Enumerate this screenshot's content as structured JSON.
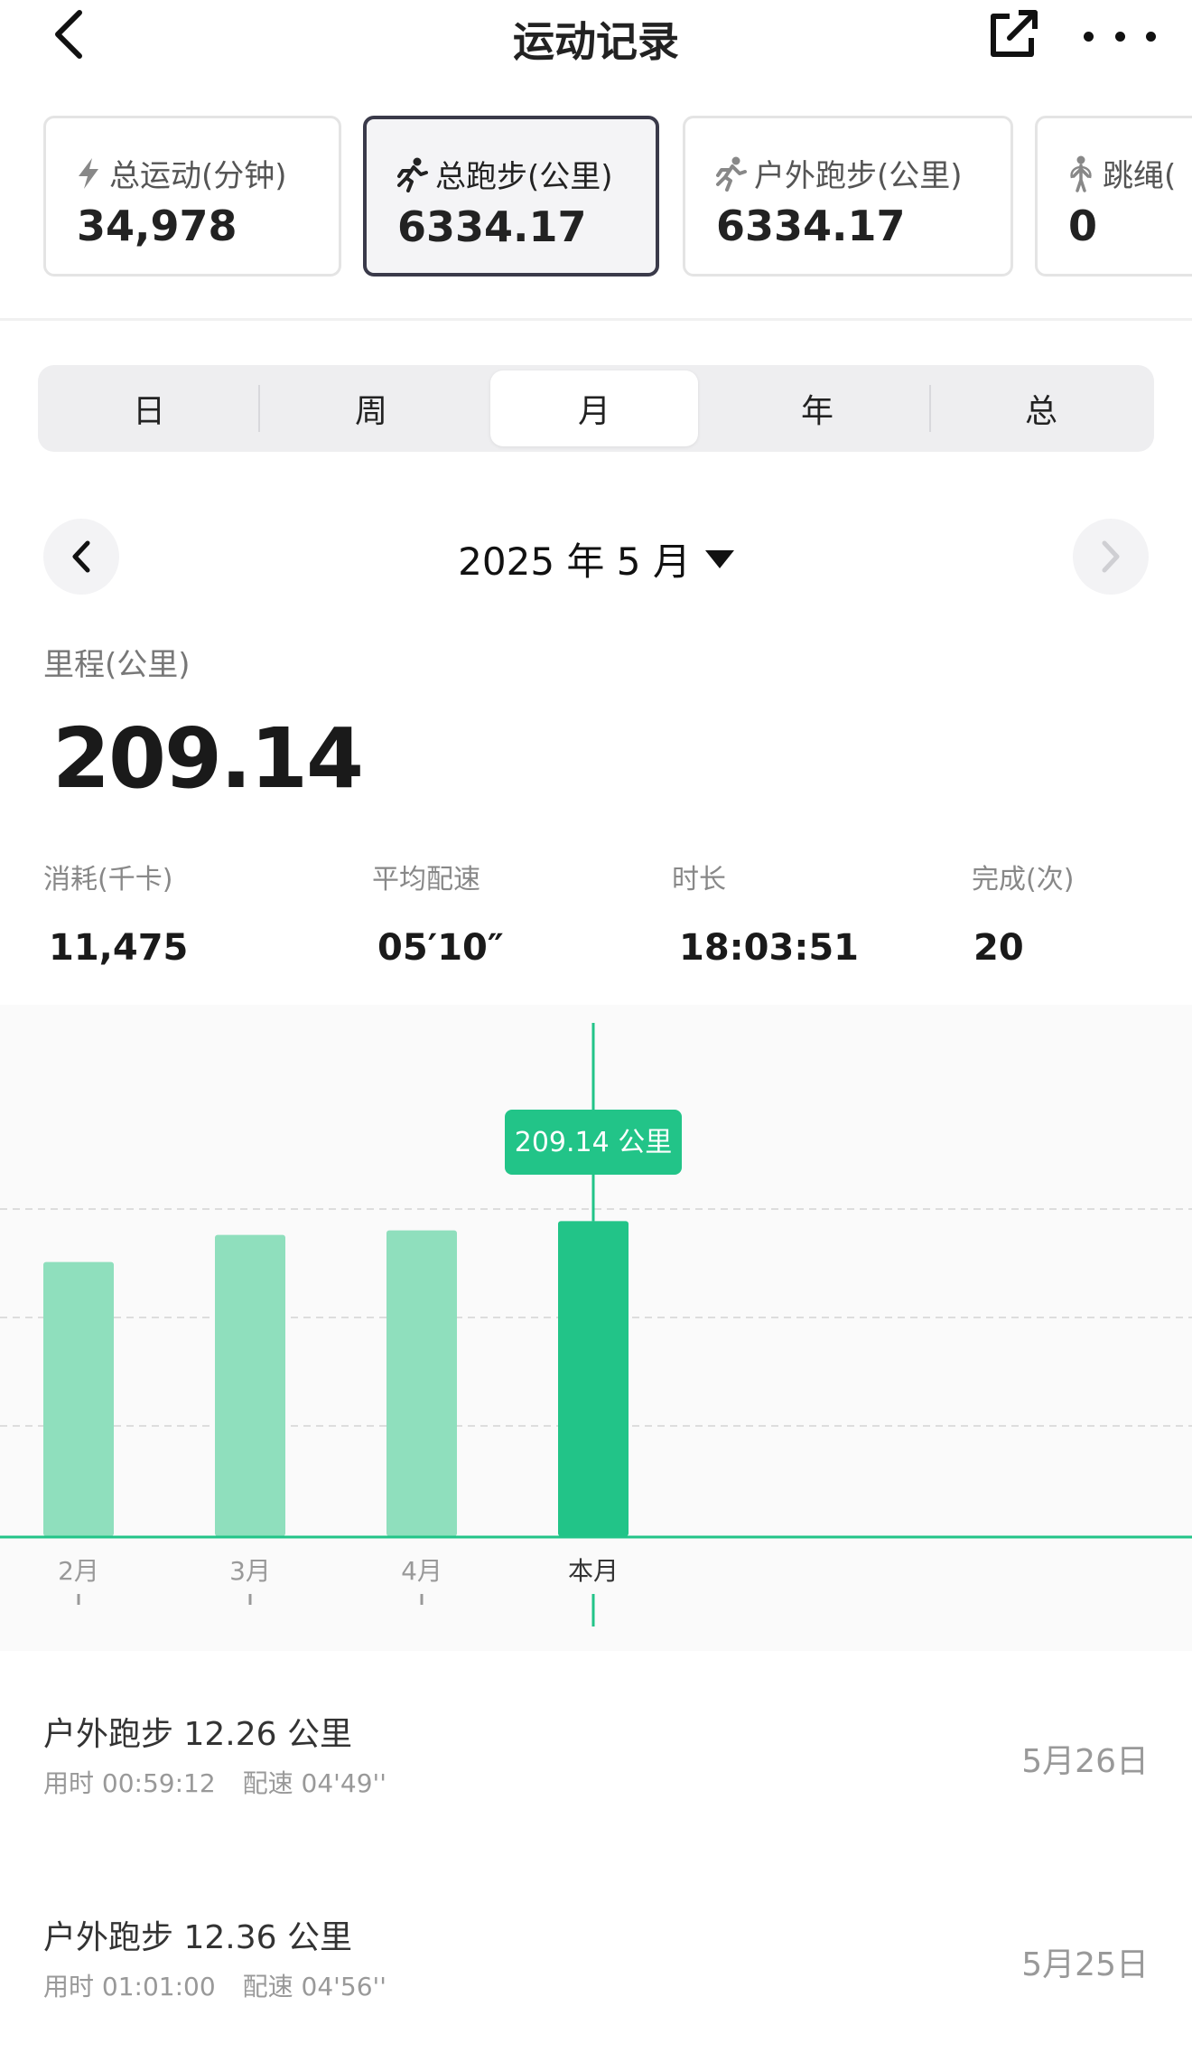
{
  "header": {
    "title": "运动记录"
  },
  "cards": [
    {
      "label": "总运动(分钟)",
      "value": "34,978",
      "icon": "lightning-icon"
    },
    {
      "label": "总跑步(公里)",
      "value": "6334.17",
      "icon": "runner-icon"
    },
    {
      "label": "户外跑步(公里)",
      "value": "6334.17",
      "icon": "outdoor-runner-icon"
    },
    {
      "label": "跳绳(",
      "value": "0",
      "icon": "jump-rope-icon"
    }
  ],
  "segments": [
    "日",
    "周",
    "月",
    "年",
    "总"
  ],
  "active_segment": "月",
  "month_picker": {
    "label": "2025 年 5 月"
  },
  "metric": {
    "label": "里程(公里)",
    "value": "209.14"
  },
  "stats": [
    {
      "label": "消耗(千卡)",
      "value": "11,475"
    },
    {
      "label": "平均配速",
      "value": "05′10″"
    },
    {
      "label": "时长",
      "value": "18:03:51"
    },
    {
      "label": "完成(次)",
      "value": "20"
    }
  ],
  "chart_data": {
    "type": "bar",
    "categories": [
      "2月",
      "3月",
      "4月",
      "本月"
    ],
    "values": [
      182,
      200,
      203,
      209.14
    ],
    "highlight_index": 3,
    "tooltip": "209.14 公里",
    "ylim": [
      0,
      210
    ],
    "grid": true,
    "colors": {
      "bar": "#8fdfbd",
      "bar_active": "#22c488",
      "axis": "#22c488",
      "grid": "#dddddd"
    }
  },
  "activities": [
    {
      "title": "户外跑步  12.26 公里",
      "duration": "用时 00:59:12",
      "pace": "配速 04'49''",
      "date": "5月26日"
    },
    {
      "title": "户外跑步  12.36 公里",
      "duration": "用时 01:01:00",
      "pace": "配速 04'56''",
      "date": "5月25日"
    }
  ]
}
